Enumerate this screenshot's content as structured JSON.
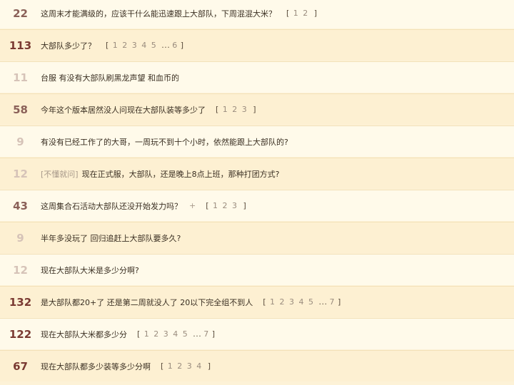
{
  "threads": [
    {
      "count": "22",
      "prefix": "",
      "title": "这周末才能满级的，应该干什么能迅速跟上大部队，下周混混大米？",
      "plus": "",
      "pages": [
        "1",
        "2"
      ],
      "last": "",
      "heat": "warm"
    },
    {
      "count": "113",
      "prefix": "",
      "title": "大部队多少了？",
      "plus": "",
      "pages": [
        "1",
        "2",
        "3",
        "4",
        "5"
      ],
      "last": "6",
      "heat": "hot"
    },
    {
      "count": "11",
      "prefix": "",
      "title": "台服 有没有大部队刷黑龙声望 和血币的",
      "plus": "",
      "pages": [],
      "last": "",
      "heat": "cool"
    },
    {
      "count": "58",
      "prefix": "",
      "title": "今年这个版本居然没人问现在大部队装等多少了",
      "plus": "",
      "pages": [
        "1",
        "2",
        "3"
      ],
      "last": "",
      "heat": "warm"
    },
    {
      "count": "9",
      "prefix": "",
      "title": "有没有已经工作了的大哥，一周玩不到十个小时，依然能跟上大部队的?",
      "plus": "",
      "pages": [],
      "last": "",
      "heat": "cool"
    },
    {
      "count": "12",
      "prefix": "[不懂就问]",
      "title": "现在正式服，大部队，还是晚上8点上班，那种打团方式?",
      "plus": "",
      "pages": [],
      "last": "",
      "heat": "cool"
    },
    {
      "count": "43",
      "prefix": "",
      "title": "这周集合石活动大部队还没开始发力吗？",
      "plus": "+",
      "pages": [
        "1",
        "2",
        "3"
      ],
      "last": "",
      "heat": "warm"
    },
    {
      "count": "9",
      "prefix": "",
      "title": "半年多没玩了 回归追赶上大部队要多久?",
      "plus": "",
      "pages": [],
      "last": "",
      "heat": "cool"
    },
    {
      "count": "12",
      "prefix": "",
      "title": "现在大部队大米是多少分啊?",
      "plus": "",
      "pages": [],
      "last": "",
      "heat": "cool"
    },
    {
      "count": "132",
      "prefix": "",
      "title": "是大部队都20+了 还是第二周就没人了 20以下完全组不到人",
      "plus": "",
      "pages": [
        "1",
        "2",
        "3",
        "4",
        "5"
      ],
      "last": "7",
      "heat": "hot"
    },
    {
      "count": "122",
      "prefix": "",
      "title": "现在大部队大米都多少分",
      "plus": "",
      "pages": [
        "1",
        "2",
        "3",
        "4",
        "5"
      ],
      "last": "7",
      "heat": "hot"
    },
    {
      "count": "67",
      "prefix": "",
      "title": "现在大部队都多少装等多少分啊",
      "plus": "",
      "pages": [
        "1",
        "2",
        "3",
        "4"
      ],
      "last": "",
      "heat": "hot"
    }
  ],
  "pager": {
    "open": "[",
    "close": "]",
    "ellipsis": "..."
  }
}
